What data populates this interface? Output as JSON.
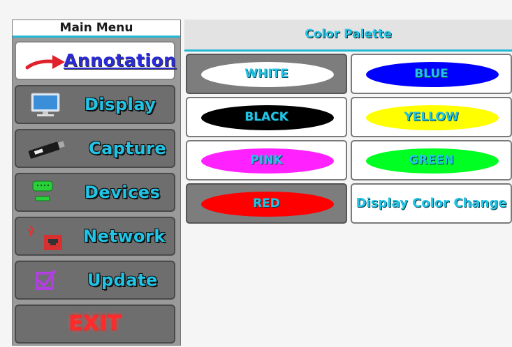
{
  "menu": {
    "title": "Main Menu",
    "items": [
      {
        "label": "Annotation",
        "icon": "red-arrow-icon"
      },
      {
        "label": "Display",
        "icon": "monitor-icon"
      },
      {
        "label": "Capture",
        "icon": "capture-card-icon"
      },
      {
        "label": "Devices",
        "icon": "serial-port-icon"
      },
      {
        "label": "Network",
        "icon": "network-port-icon"
      },
      {
        "label": "Update",
        "icon": "checkbox-icon"
      },
      {
        "label": "EXIT"
      }
    ]
  },
  "palette": {
    "title": "Color Palette",
    "colors": [
      {
        "label": "WHITE",
        "fill": "#ffffff"
      },
      {
        "label": "BLUE",
        "fill": "#0000ff"
      },
      {
        "label": "BLACK",
        "fill": "#000000"
      },
      {
        "label": "YELLOW",
        "fill": "#ffff00"
      },
      {
        "label": "PINK",
        "fill": "#ff22ff"
      },
      {
        "label": "GREEN",
        "fill": "#00ff22"
      },
      {
        "label": "RED",
        "fill": "#ff0000"
      }
    ],
    "display_color_change": "Display Color Change"
  },
  "accent_color": "#22c4e6"
}
